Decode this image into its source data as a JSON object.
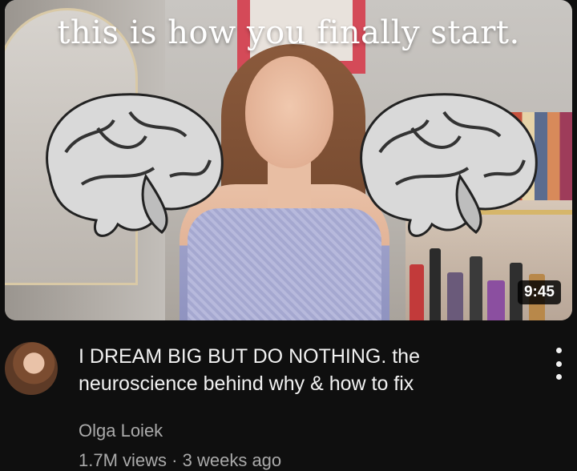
{
  "video": {
    "thumbnail_text": "this is how you finally start.",
    "duration": "9:45",
    "title": "I DREAM BIG BUT DO NOTHING. the neuroscience behind why & how to fix",
    "channel": "Olga Loiek",
    "views": "1.7M views",
    "separator": "·",
    "age": "3 weeks ago"
  },
  "icons": {
    "menu": "more-vert-icon",
    "brain": "brain-illustration"
  },
  "colors": {
    "background": "#0f0f0f",
    "title_text": "#f1f1f1",
    "secondary_text": "#aaaaaa",
    "duration_badge": "#000000"
  }
}
